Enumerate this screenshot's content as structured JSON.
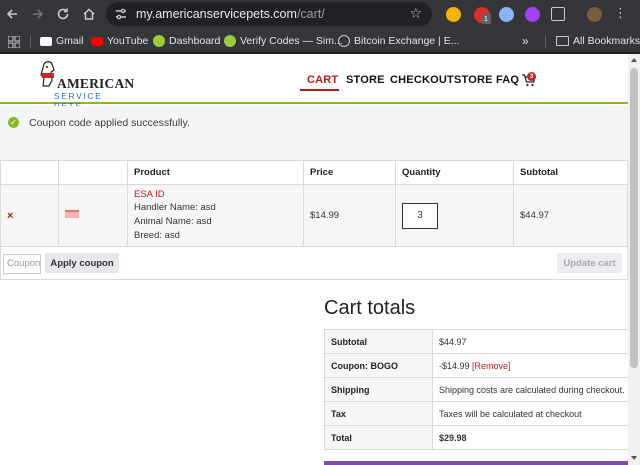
{
  "browser": {
    "url_host": "my.americanservicepets.com",
    "url_path": "/cart/",
    "bookmarks": [
      {
        "label": "Gmail",
        "icon": "gmail-icon"
      },
      {
        "label": "YouTube",
        "icon": "youtube-icon"
      },
      {
        "label": "Dashboard",
        "icon": "check-circle-icon"
      },
      {
        "label": "Verify Codes — Sim...",
        "icon": "check-circle-icon"
      },
      {
        "label": "Bitcoin Exchange | E...",
        "icon": "globe-icon"
      }
    ],
    "more_bookmarks": "»",
    "all_bookmarks": "All Bookmarks",
    "ext_badge": "1"
  },
  "site": {
    "logo_line1": "AMERICAN",
    "logo_line2": "SERVICE PETS",
    "nav": [
      "CART",
      "STORE",
      "CHECKOUT",
      "STORE FAQ"
    ],
    "cart_count": "3",
    "accent": "#b71c1c",
    "green": "#8fb52b"
  },
  "notice": {
    "text": "Coupon code applied successfully."
  },
  "cart_table": {
    "headers": [
      "",
      "",
      "Product",
      "Price",
      "Quantity",
      "Subtotal"
    ],
    "row": {
      "remove": "×",
      "product_name": "ESA ID",
      "handler": "Handler Name: asd",
      "animal": "Animal Name: asd",
      "breed": "Breed: asd",
      "price": "$14.99",
      "quantity": "3",
      "subtotal": "$44.97"
    }
  },
  "actions": {
    "coupon_placeholder": "Coupon code",
    "apply_label": "Apply coupon",
    "update_label": "Update cart"
  },
  "totals": {
    "title": "Cart totals",
    "rows": [
      {
        "label": "Subtotal",
        "value": "$44.97"
      },
      {
        "label": "Coupon: BOGO",
        "value": "-$14.99",
        "link": "[Remove]"
      },
      {
        "label": "Shipping",
        "value": "Shipping costs are calculated during checkout."
      },
      {
        "label": "Tax",
        "value": "Taxes will be calculated at checkout"
      },
      {
        "label": "Total",
        "value": "$29.98"
      }
    ]
  }
}
